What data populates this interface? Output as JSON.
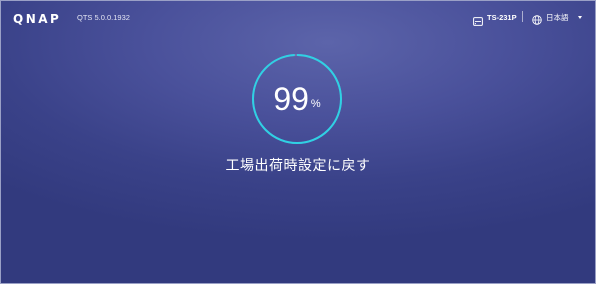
{
  "header": {
    "logo": "QNAP",
    "version": "QTS 5.0.0.1932",
    "device_name": "TS-231P",
    "language": "日本語"
  },
  "progress": {
    "value": "99",
    "unit": "%",
    "fraction": 0.99,
    "ring_color": "#2fd1e4"
  },
  "status": {
    "message": "工場出荷時設定に戻す"
  },
  "icons": {
    "device": "nas-device-icon",
    "language": "globe-icon",
    "dropdown": "caret-down-icon"
  }
}
